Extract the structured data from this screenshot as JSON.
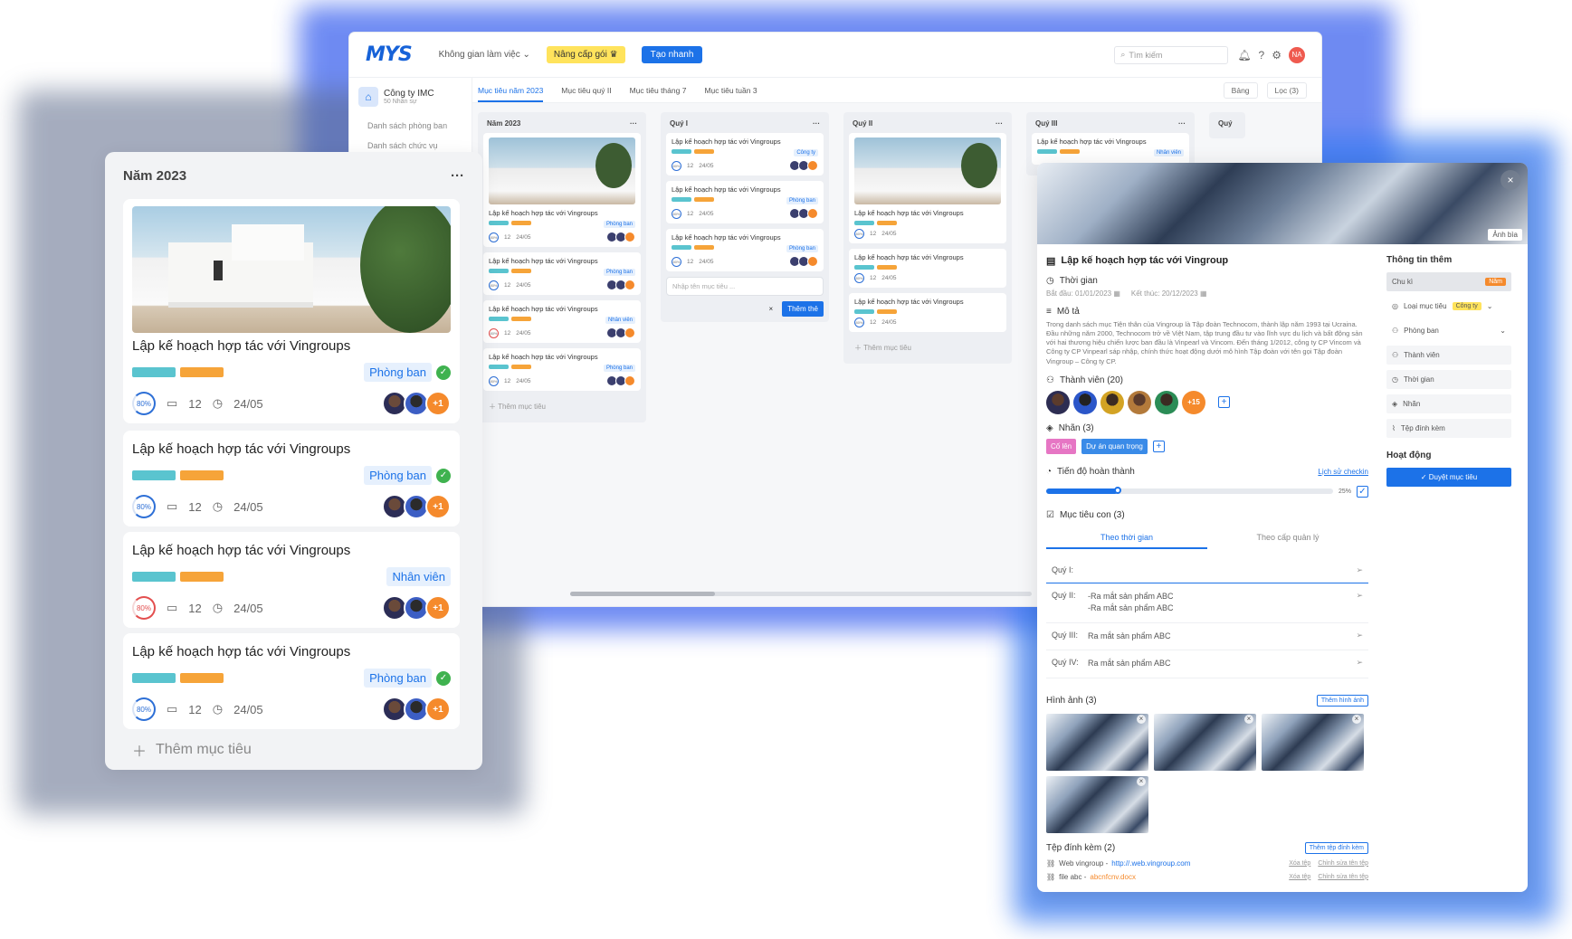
{
  "topbar": {
    "logo": "MYS",
    "workspace": "Không gian làm việc",
    "upgrade": "Nâng cấp gói",
    "quick_create": "Tạo nhanh",
    "search_placeholder": "Tìm kiếm",
    "user_initials": "NA"
  },
  "sidebar": {
    "company": "Công ty IMC",
    "company_sub": "50 Nhân sự",
    "items": [
      "Danh sách phòng ban",
      "Danh sách chức vụ"
    ]
  },
  "tabs": {
    "items": [
      "Mục tiêu năm 2023",
      "Mục tiêu quý II",
      "Mục tiêu tháng 7",
      "Mục tiêu tuần 3"
    ],
    "view": "Bảng",
    "filter": "Lọc (3)"
  },
  "board": {
    "columns": [
      "Năm 2023",
      "Quý I",
      "Quý II",
      "Quý III",
      "Quý"
    ],
    "card_title": "Lập kế hoạch hợp tác với Vingroups",
    "comments": "12",
    "due": "24/05",
    "progress": "80%",
    "progress_sm": "80%",
    "extra": "+1",
    "tag_dept": "Phòng ban",
    "tag_staff": "Nhân viên",
    "tag_company": "Công ty",
    "add_goal": "Thêm mục tiêu",
    "input_placeholder": "Nhập tên mục tiêu ...",
    "add_card": "Thêm thẻ"
  },
  "bigcol": {
    "title": "Năm 2023",
    "add": "Thêm mục tiêu"
  },
  "detail": {
    "cover_label": "Ảnh bìa",
    "title": "Lập kế hoạch hợp tác với Vingroup",
    "time_label": "Thời gian",
    "start_label": "Bắt đầu:",
    "start": "01/01/2023",
    "end_label": "Kết thúc:",
    "end": "20/12/2023",
    "desc_label": "Mô tả",
    "desc": "Trong danh sách mục Tiện thân của Vingroup là Tập đoàn Technocom, thành lập năm 1993 tại Ucraina. Đầu những năm 2000, Technocom trở về Việt Nam, tập trung đầu tư vào lĩnh vực du lịch và bất động sản với hai thương hiệu chiến lược ban đầu là Vinpearl và Vincom. Đến tháng 1/2012, công ty CP Vincom và Công ty CP Vinpearl sáp nhập, chính thức hoạt động dưới mô hình Tập đoàn với tên gọi Tập đoàn Vingroup – Công ty CP.",
    "members_label": "Thành viên (20)",
    "members_extra": "+15",
    "labels_label": "Nhãn (3)",
    "label1": "Cố lên",
    "label2": "Dự án quan trọng",
    "progress_label": "Tiến độ hoàn thành",
    "progress_history": "Lịch sử checkin",
    "progress_value": "25%",
    "sub_label": "Mục tiêu con (3)",
    "sub_tab1": "Theo thời gian",
    "sub_tab2": "Theo cấp quản lý",
    "quarters": [
      {
        "label": "Quý  I:",
        "value": ""
      },
      {
        "label": "Quý  II:",
        "value": "-Ra mắt sản phẩm ABC",
        "value2": "-Ra mắt sản phẩm ABC"
      },
      {
        "label": "Quý III:",
        "value": "Ra mắt sản phẩm ABC"
      },
      {
        "label": "Quý IV:",
        "value": "Ra mắt sản phẩm ABC"
      }
    ],
    "images_label": "Hình ảnh (3)",
    "add_image": "Thêm hình ảnh",
    "attach_label": "Tệp đính kèm (2)",
    "add_attach": "Thêm tệp đính kèm",
    "attachments": [
      {
        "name": "Web vingroup -",
        "url": "http://.web.vingroup.com"
      },
      {
        "name": "file abc -",
        "url": "abcnfcnv.docx"
      }
    ],
    "att_delete": "Xóa tệp",
    "att_edit": "Chỉnh sửa tên tệp"
  },
  "detail_side": {
    "title": "Thông tin thêm",
    "items": [
      "Chu kì",
      "Loại mục tiêu",
      "Phòng ban",
      "Thành viên",
      "Thời gian",
      "Nhãn",
      "Tệp đính kèm"
    ],
    "cycle_tag": "Năm",
    "type_tag": "Công ty",
    "activity": "Hoạt động",
    "approve": "Duyệt mục tiêu"
  }
}
